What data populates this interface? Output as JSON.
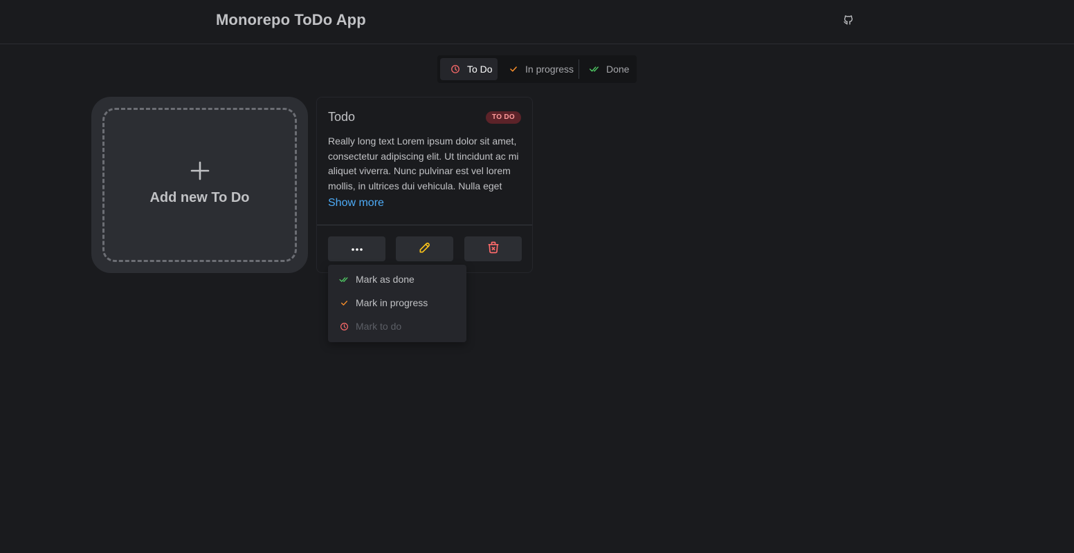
{
  "header": {
    "title": "Monorepo ToDo App",
    "github_icon": "github-icon"
  },
  "filter": {
    "options": [
      {
        "label": "To Do",
        "icon": "clock-icon",
        "color": "#ff6b6b",
        "active": true
      },
      {
        "label": "In progress",
        "icon": "check-icon",
        "color": "#ff922b",
        "active": false
      },
      {
        "label": "Done",
        "icon": "double-check-icon",
        "color": "#51cf66",
        "active": false
      }
    ]
  },
  "add_card": {
    "label": "Add new To Do",
    "icon": "plus-icon"
  },
  "todo": {
    "title": "Todo",
    "status_badge": "TO DO",
    "badge_color": "#ff9b9b",
    "description": "Really long text Lorem ipsum dolor sit amet, consectetur adipiscing elit. Ut tincidunt ac mi aliquet viverra. Nunc pulvinar est vel lorem mollis, in ultrices dui vehicula. Nulla eget",
    "show_more": "Show more",
    "actions": [
      {
        "icon": "dots-icon",
        "color": "#ffffff"
      },
      {
        "icon": "pencil-icon",
        "color": "#fcc419"
      },
      {
        "icon": "trash-x-icon",
        "color": "#ff6b6b"
      }
    ]
  },
  "status_menu": {
    "items": [
      {
        "label": "Mark as done",
        "icon": "double-check-icon",
        "color": "#51cf66",
        "disabled": false
      },
      {
        "label": "Mark in progress",
        "icon": "check-icon",
        "color": "#ff922b",
        "disabled": false
      },
      {
        "label": "Mark to do",
        "icon": "clock-icon",
        "color": "#ff6b6b",
        "disabled": true
      }
    ]
  },
  "colors": {
    "background": "#1a1b1e",
    "surface": "#2c2e33",
    "link": "#4dabf7"
  }
}
